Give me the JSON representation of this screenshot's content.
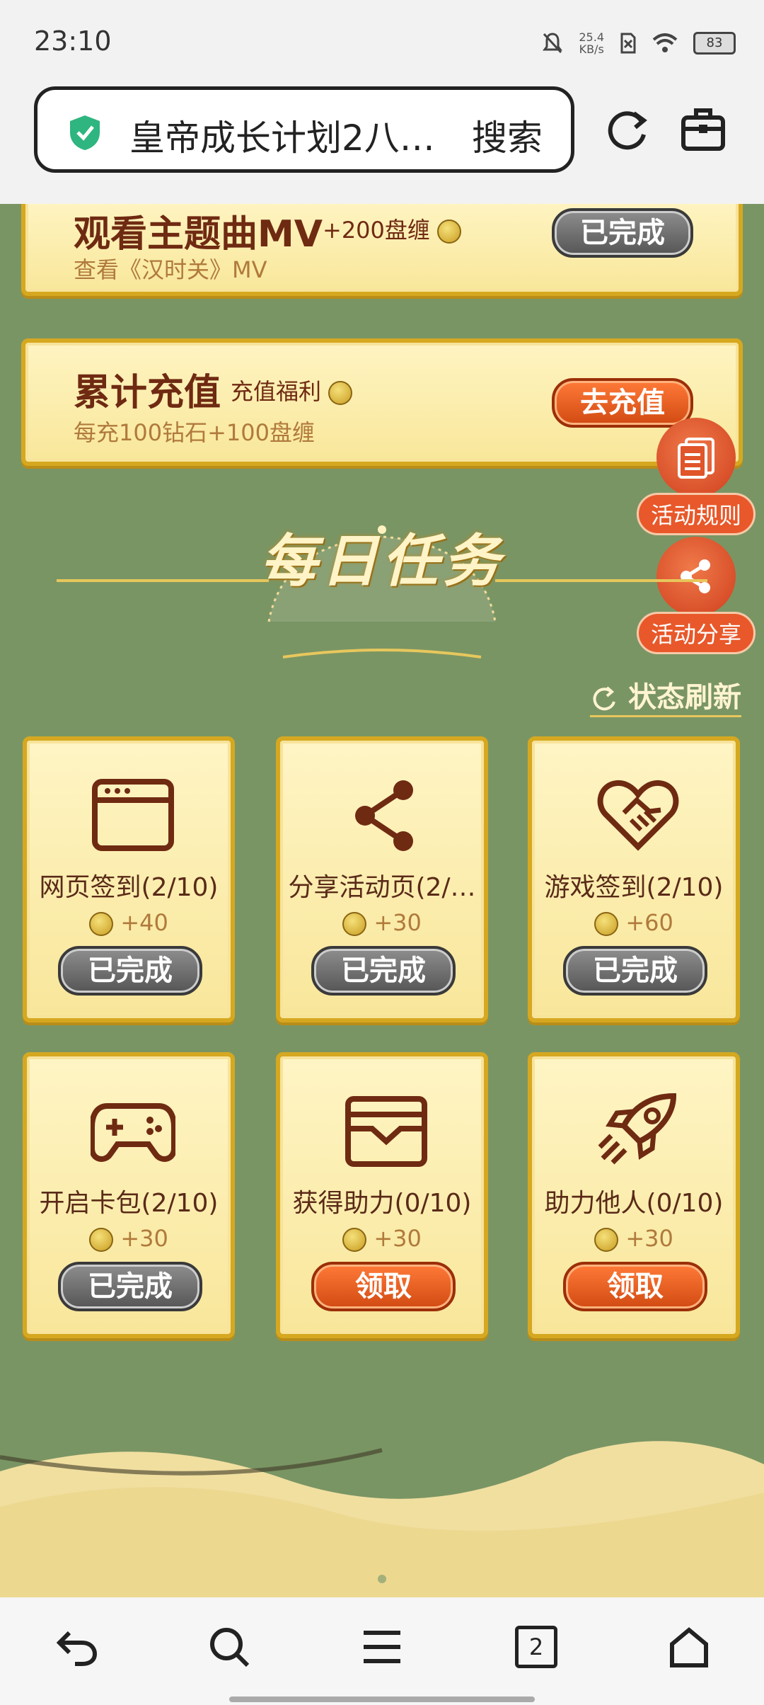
{
  "status_bar": {
    "time": "23:10",
    "net_speed_value": "25.4",
    "net_speed_unit": "KB/s",
    "battery": "83"
  },
  "browser": {
    "url_text": "皇帝成长计划2八…",
    "search_label": "搜索"
  },
  "tasks_top": [
    {
      "title": "观看主题曲MV",
      "tag": "+200盘缠",
      "desc": "查看《汉时关》MV",
      "button": "已完成"
    },
    {
      "title": "累计充值",
      "tag": "充值福利",
      "desc": "每充100钻石+100盘缠",
      "button": "去充值"
    }
  ],
  "side_buttons": {
    "rules": "活动规则",
    "share": "活动分享"
  },
  "daily": {
    "title": "每日任务",
    "refresh": "状态刷新"
  },
  "tiles": [
    {
      "label": "网页签到(2/10)",
      "reward": "+40",
      "button": "已完成",
      "icon": "browser-window-icon"
    },
    {
      "label": "分享活动页(2/…",
      "reward": "+30",
      "button": "已完成",
      "icon": "share-icon"
    },
    {
      "label": "游戏签到(2/10)",
      "reward": "+60",
      "button": "已完成",
      "icon": "handshake-heart-icon"
    },
    {
      "label": "开启卡包(2/10)",
      "reward": "+30",
      "button": "已完成",
      "icon": "gamepad-icon"
    },
    {
      "label": "获得助力(0/10)",
      "reward": "+30",
      "button": "领取",
      "icon": "wallet-icon"
    },
    {
      "label": "助力他人(0/10)",
      "reward": "+30",
      "button": "领取",
      "icon": "rocket-icon"
    }
  ],
  "bottom_nav": {
    "tabs_count": "2"
  },
  "colors": {
    "background_green": "#7a9564",
    "card_gold": "#d6a820",
    "done_gray": "#555555",
    "action_orange": "#d14a12",
    "title_brown": "#6f2a12"
  }
}
